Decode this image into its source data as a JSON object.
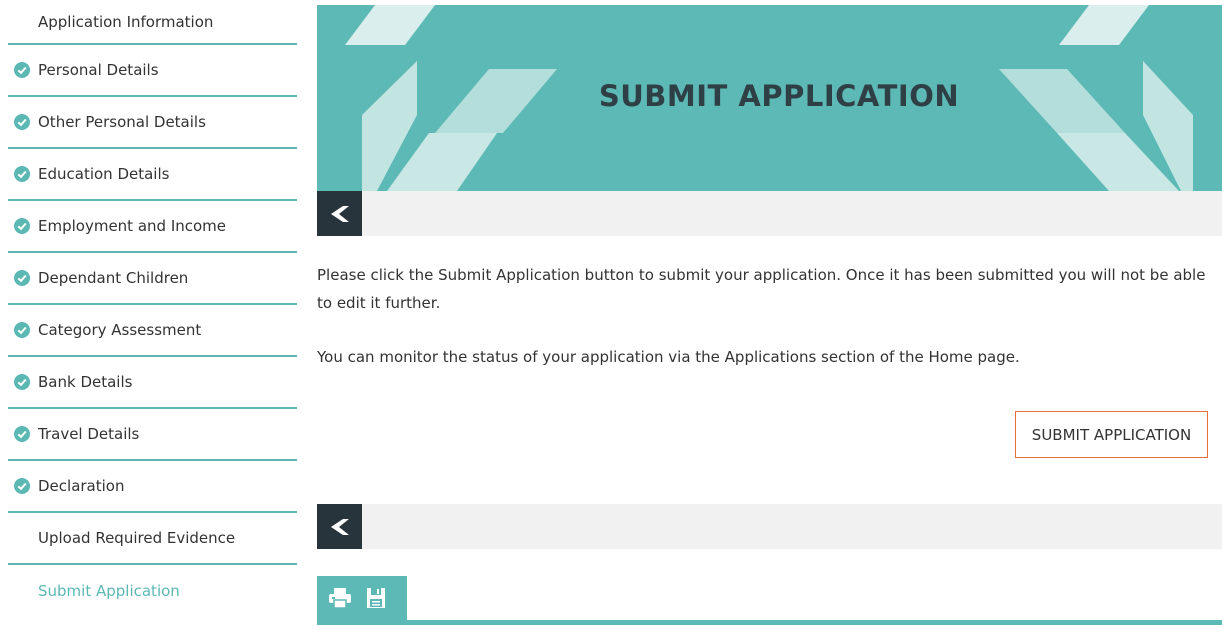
{
  "sidebar": {
    "items": [
      {
        "label": "Application Information",
        "completed": false
      },
      {
        "label": "Personal Details",
        "completed": true
      },
      {
        "label": "Other Personal Details",
        "completed": true
      },
      {
        "label": "Education Details",
        "completed": true
      },
      {
        "label": "Employment and Income",
        "completed": true
      },
      {
        "label": "Dependant Children",
        "completed": true
      },
      {
        "label": "Category Assessment",
        "completed": true
      },
      {
        "label": "Bank Details",
        "completed": true
      },
      {
        "label": "Travel Details",
        "completed": true
      },
      {
        "label": "Declaration",
        "completed": true
      },
      {
        "label": "Upload Required Evidence",
        "completed": false
      },
      {
        "label": "Submit Application",
        "completed": false,
        "active": true
      }
    ]
  },
  "banner": {
    "title": "SUBMIT APPLICATION"
  },
  "main": {
    "instructions": "Please click the Submit Application button to submit your application. Once it has been submitted you will not be able to edit it further.",
    "status_note": "You can monitor the status of your application via the Applications section of the Home page.",
    "submit_label": "SUBMIT APPLICATION"
  },
  "icons": {
    "back": "back-arrow-icon",
    "print": "print-icon",
    "save": "save-icon",
    "check": "check-circle-icon"
  },
  "colors": {
    "accent": "#5db9b5",
    "dark": "#27343b",
    "button_border": "#e2703a",
    "check": "#5bb8b3"
  }
}
